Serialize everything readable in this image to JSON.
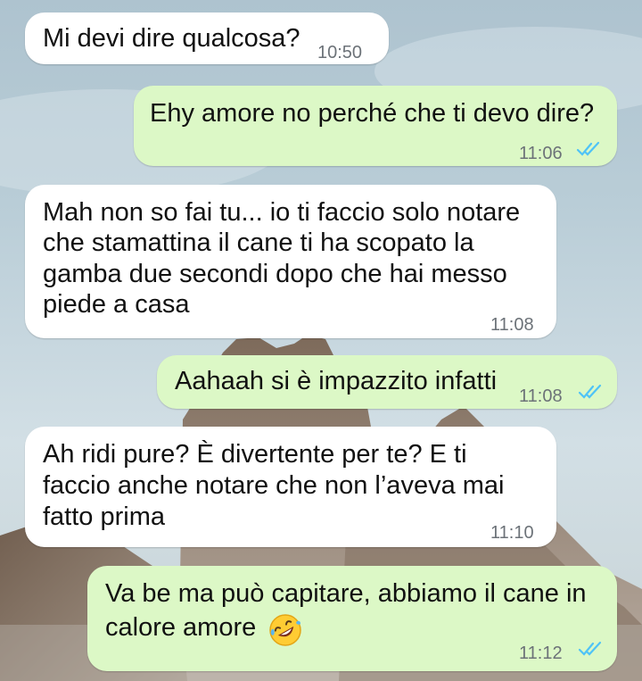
{
  "chat": {
    "messages": [
      {
        "direction": "incoming",
        "text": "Mi devi dire qualcosa?",
        "time": "10:50"
      },
      {
        "direction": "outgoing",
        "text": "Ehy amore no perché che ti devo dire?",
        "time": "11:06",
        "status": "read"
      },
      {
        "direction": "incoming",
        "lines": [
          "Mah non so fai tu... io ti faccio solo notare",
          "che stamattina il cane ti ha scopato la",
          "gamba due secondi dopo che hai messo",
          "piede a casa"
        ],
        "time": "11:08"
      },
      {
        "direction": "outgoing",
        "text": "Aahaah si è impazzito infatti",
        "time": "11:08",
        "status": "read"
      },
      {
        "direction": "incoming",
        "lines": [
          "Ah ridi pure? È divertente per te? E ti",
          "faccio anche notare che non l’aveva mai",
          "fatto prima"
        ],
        "time": "11:10"
      },
      {
        "direction": "outgoing",
        "lines": [
          "Va be ma può capitare, abbiamo il cane in",
          "calore amore"
        ],
        "emoji": "rolling-on-floor-laughing-emoji",
        "time": "11:12",
        "status": "read"
      }
    ]
  },
  "colors": {
    "incoming_bubble": "#ffffff",
    "outgoing_bubble": "#dcf8c6",
    "read_ticks": "#4fc3f7",
    "timestamp": "#6c7278"
  }
}
